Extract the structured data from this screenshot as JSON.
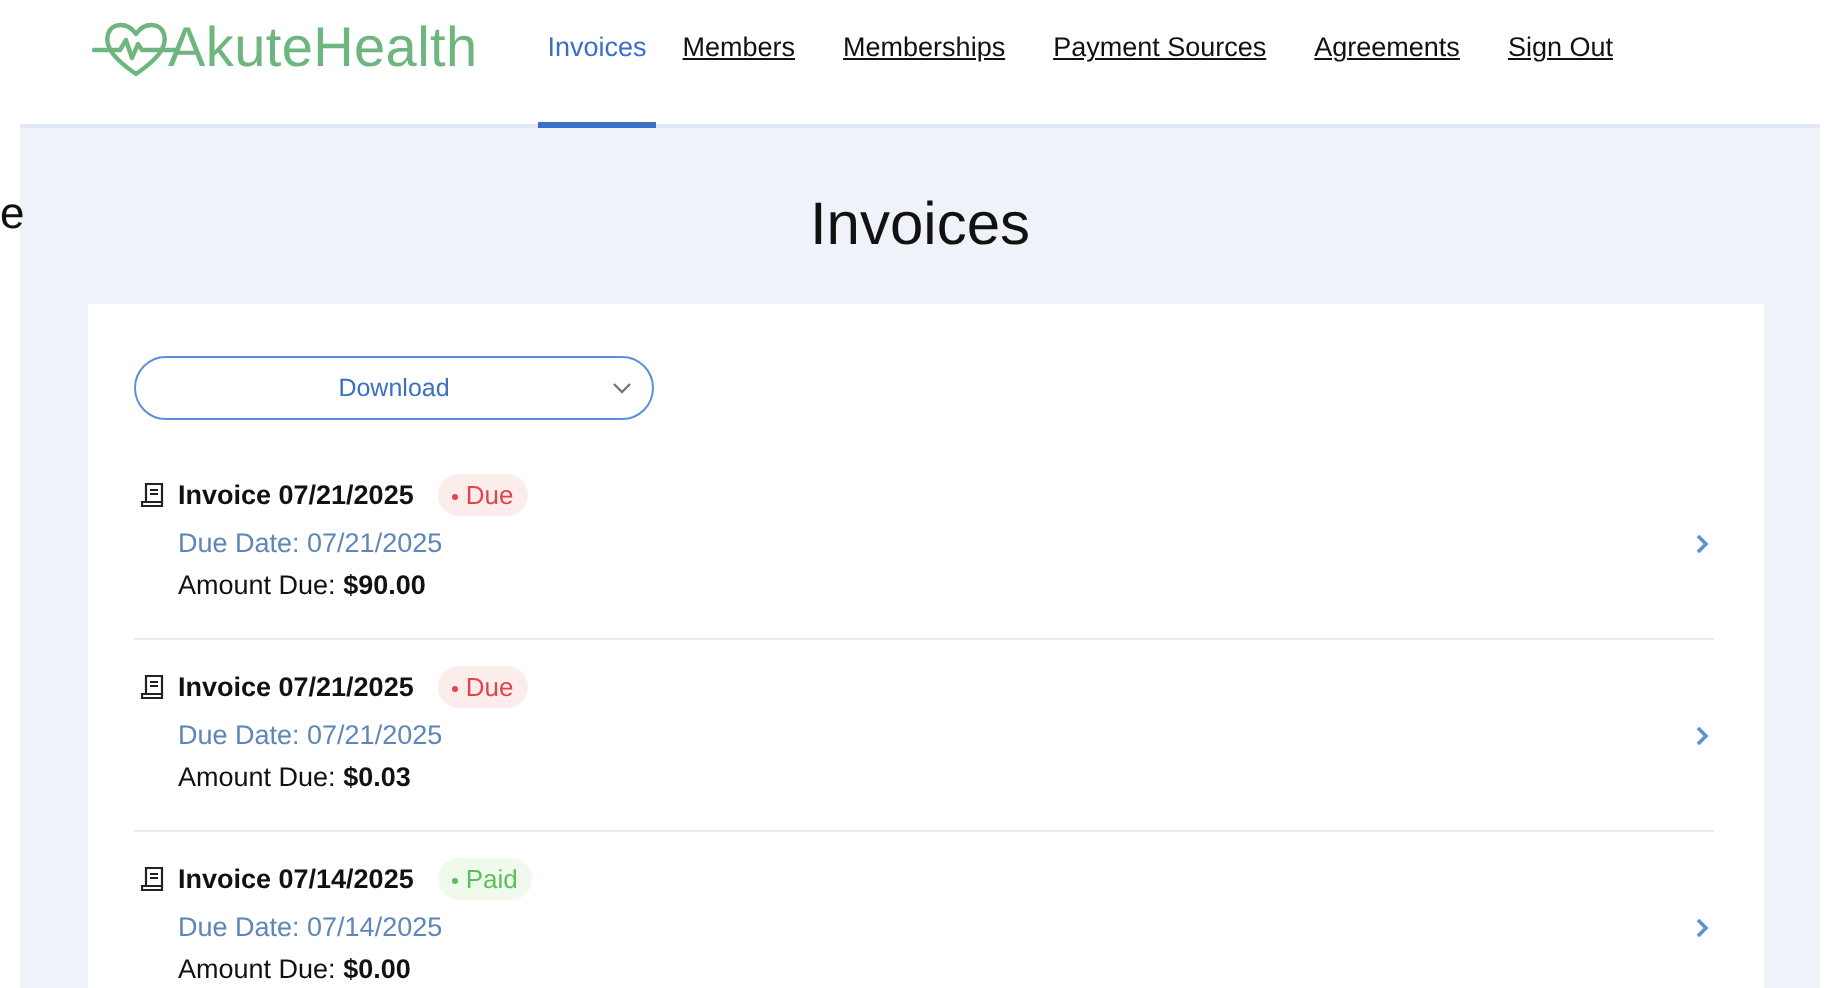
{
  "edge_fragment": "e",
  "header": {
    "logo": "AkuteHealth",
    "nav": [
      {
        "label": "Invoices",
        "selected": true
      },
      {
        "label": "Members",
        "selected": false
      },
      {
        "label": "Memberships",
        "selected": false
      },
      {
        "label": "Payment Sources",
        "selected": false
      },
      {
        "label": "Agreements",
        "selected": false
      },
      {
        "label": "Sign Out",
        "selected": false
      }
    ]
  },
  "page_title": "Invoices",
  "download": {
    "label": "Download"
  },
  "invoices": [
    {
      "title": "Invoice 07/21/2025",
      "status": {
        "label": "Due",
        "kind": "due"
      },
      "due_date": "Due Date: 07/21/2025",
      "amount_label": "Amount Due:",
      "amount": "$90.00"
    },
    {
      "title": "Invoice 07/21/2025",
      "status": {
        "label": "Due",
        "kind": "due"
      },
      "due_date": "Due Date: 07/21/2025",
      "amount_label": "Amount Due:",
      "amount": "$0.03"
    },
    {
      "title": "Invoice 07/14/2025",
      "status": {
        "label": "Paid",
        "kind": "paid"
      },
      "due_date": "Due Date: 07/14/2025",
      "amount_label": "Amount Due:",
      "amount": "$0.00"
    }
  ]
}
